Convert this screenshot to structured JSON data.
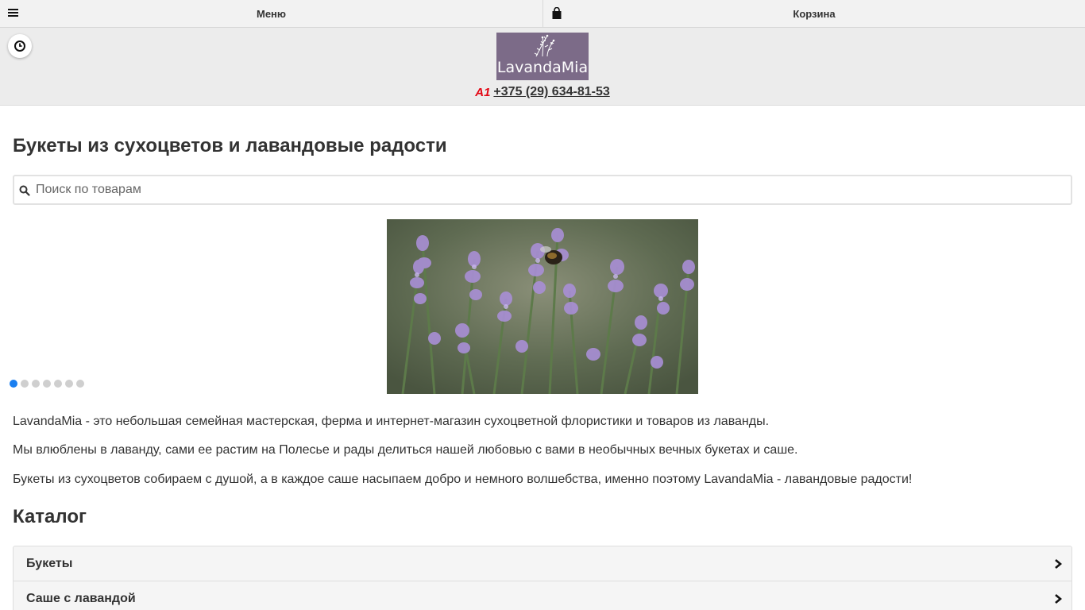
{
  "topbar": {
    "menu_label": "Меню",
    "cart_label": "Корзина"
  },
  "header": {
    "logo_text": "LavandaMia",
    "phone_prefix": "A1",
    "phone": "+375 (29) 634-81-53"
  },
  "main": {
    "title": "Букеты из сухоцветов и лавандовые радости",
    "search_placeholder": "Поиск по товарам",
    "slider": {
      "slide_count": 7,
      "active_index": 0
    },
    "about": [
      "LavandaMia - это небольшая семейная мастерская, ферма и интернет-магазин сухоцветной флористики  и товаров из лаванды.",
      "Мы влюблены в лаванду, сами ее растим на Полесье и рады делиться нашей любовью с вами в необычных вечных букетах и саше.",
      "Букеты из сухоцветов собираем с душой, а в каждое саше насыпаем добро и немного волшебства, именно поэтому LavandaMia - лавандовые радости!"
    ]
  },
  "catalog": {
    "title": "Каталог",
    "items": [
      {
        "label": "Букеты"
      },
      {
        "label": "Саше с лавандой"
      }
    ]
  },
  "colors": {
    "accent": "#1a7ff0",
    "logo_bg": "#7c6b88",
    "a1_red": "#e30613"
  },
  "icons": [
    "menu-icon",
    "bag-icon",
    "clock-icon",
    "search-icon",
    "chevron-right-icon",
    "lavender-sprig-icon"
  ]
}
